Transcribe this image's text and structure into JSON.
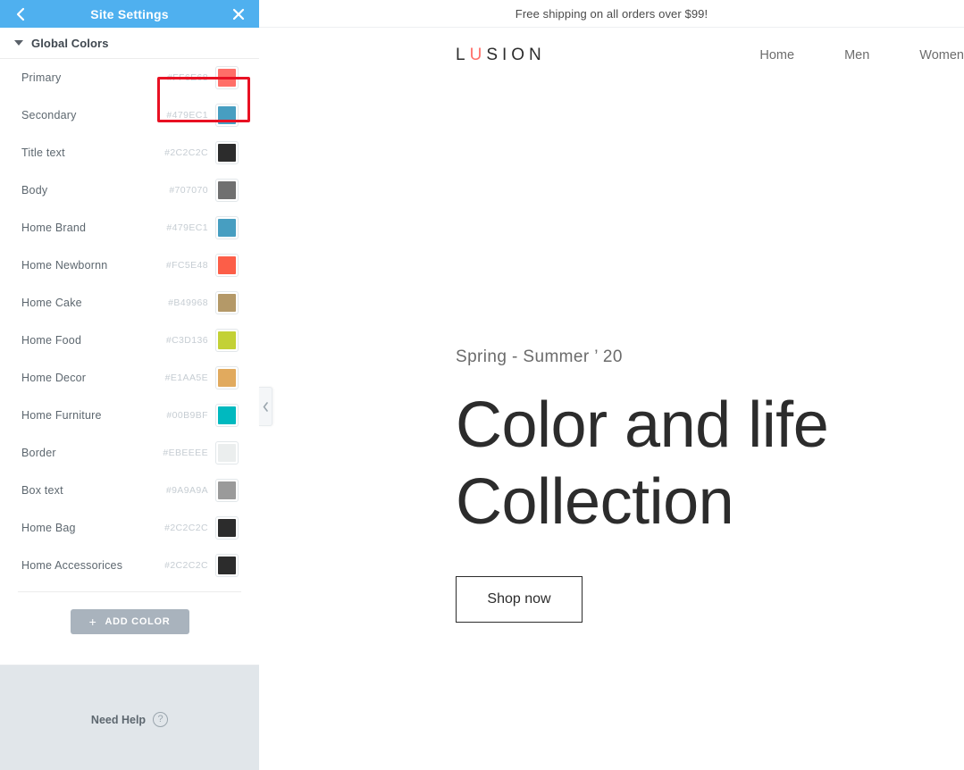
{
  "panel": {
    "header": {
      "title": "Site Settings",
      "back_icon": "chevron-left-icon",
      "close_icon": "close-icon"
    },
    "section": {
      "title": "Global Colors",
      "caret_icon": "caret-down-icon"
    },
    "colors": [
      {
        "name": "Primary",
        "hex": "#FF6E68",
        "swatch": "#FF6E68"
      },
      {
        "name": "Secondary",
        "hex": "#479EC1",
        "swatch": "#479EC1"
      },
      {
        "name": "Title text",
        "hex": "#2C2C2C",
        "swatch": "#2C2C2C"
      },
      {
        "name": "Body",
        "hex": "#707070",
        "swatch": "#707070"
      },
      {
        "name": "Home Brand",
        "hex": "#479EC1",
        "swatch": "#479EC1"
      },
      {
        "name": "Home Newbornn",
        "hex": "#FC5E48",
        "swatch": "#FC5E48"
      },
      {
        "name": "Home Cake",
        "hex": "#B49968",
        "swatch": "#B49968"
      },
      {
        "name": "Home Food",
        "hex": "#C3D136",
        "swatch": "#C3D136"
      },
      {
        "name": "Home Decor",
        "hex": "#E1AA5E",
        "swatch": "#E1AA5E"
      },
      {
        "name": "Home Furniture",
        "hex": "#00B9BF",
        "swatch": "#00B9BF"
      },
      {
        "name": "Border",
        "hex": "#EBEEEE",
        "swatch": "#EBEEEE"
      },
      {
        "name": "Box text",
        "hex": "#9A9A9A",
        "swatch": "#9A9A9A"
      },
      {
        "name": "Home Bag",
        "hex": "#2C2C2C",
        "swatch": "#2C2C2C"
      },
      {
        "name": "Home Accessorices",
        "hex": "#2C2C2C",
        "swatch": "#2C2C2C"
      }
    ],
    "add_color": {
      "label": "ADD COLOR",
      "plus": "+"
    },
    "footer": {
      "need_help": "Need Help",
      "help_icon": "question-mark-icon"
    },
    "collapse_handle_icon": "chevron-left-icon",
    "highlight_color": "#E81123"
  },
  "preview": {
    "shipping_banner": "Free shipping on all orders over $99!",
    "logo": {
      "before": "L",
      "accent": "U",
      "after": "SION",
      "accent_color": "#FF6E68"
    },
    "nav": [
      {
        "label": "Home"
      },
      {
        "label": "Men"
      },
      {
        "label": "Women"
      }
    ],
    "hero": {
      "subtitle": "Spring - Summer ’ 20",
      "title": "Color and life\nCollection",
      "cta": "Shop now"
    }
  }
}
